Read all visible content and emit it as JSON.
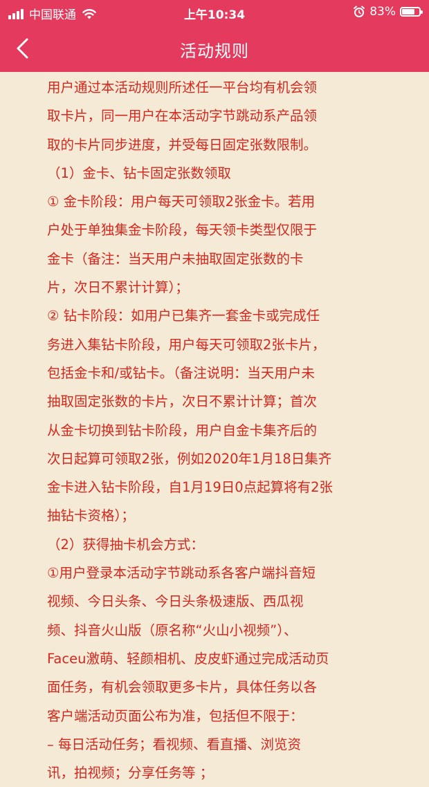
{
  "status_bar": {
    "carrier": "中国联通",
    "time": "上午10:34",
    "battery_percent": "83%",
    "battery_level": 0.83,
    "icons": [
      "signal-icon",
      "wifi-icon",
      "alarm-icon",
      "battery-icon"
    ]
  },
  "nav": {
    "title": "活动规则",
    "back_icon": "chevron-left-icon",
    "bg_color": "#e33a5e"
  },
  "rules": {
    "text_color": "#d4281f",
    "lines": [
      " 用户通过本活动规则所述任一平台均有机会领",
      "取卡片，同一用户在本活动字节跳动系产品领",
      "取的卡片同步进度，并受每日固定张数限制。",
      "（1）金卡、钻卡固定张数领取",
      " ① 金卡阶段：用户每天可领取2张金卡。若用",
      "户处于单独集金卡阶段，每天领卡类型仅限于",
      "金卡（备注：当天用户未抽取固定张数的卡",
      "片，次日不累计计算）；",
      "② 钻卡阶段：如用户已集齐一套金卡或完成任",
      "务进入集钻卡阶段，用户每天可领取2张卡片，",
      "包括金卡和/或钻卡。（备注说明：当天用户未",
      "抽取固定张数的卡片，次日不累计计算；首次",
      "从金卡切换到钻卡阶段，用户自金卡集齐后的",
      "次日起算可领取2张，例如2020年1月18日集齐",
      "金卡进入钻卡阶段，自1月19日0点起算将有2张",
      "抽钻卡资格）；",
      "（2）获得抽卡机会方式：",
      " ①用户登录本活动字节跳动系各客户端抖音短",
      "视频、今日头条、今日头条极速版、西瓜视",
      "频、抖音火山版（原名称“火山小视频”）、",
      "Faceu激萌、轻颜相机、皮皮虾通过完成活动页",
      "面任务，有机会领取更多卡片，具体任务以各",
      "客户端活动页面公布为准，包括但不限于：",
      "– 每日活动任务；看视频、看直播、浏览资",
      "讯，拍视频；分享任务等 ；"
    ]
  }
}
